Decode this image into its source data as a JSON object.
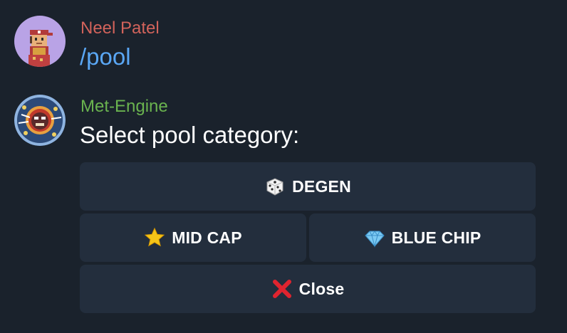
{
  "messages": [
    {
      "sender": "Neel Patel",
      "sender_color": "#d2635b",
      "text": "/pool",
      "text_color": "#5aa7f5",
      "avatar_icon": "pixel-character-avatar"
    },
    {
      "sender": "Met-Engine",
      "sender_color": "#6ab34f",
      "text": "Select pool category:",
      "text_color": "#ffffff",
      "avatar_icon": "meteor-avatar"
    }
  ],
  "keyboard": {
    "degen": {
      "icon": "dice-icon",
      "label": "DEGEN"
    },
    "mid_cap": {
      "icon": "star-icon",
      "label": "MID CAP"
    },
    "blue_chip": {
      "icon": "gem-icon",
      "label": "BLUE CHIP"
    },
    "close": {
      "icon": "cross-mark-icon",
      "label": "Close"
    }
  },
  "colors": {
    "background": "#1a222c",
    "button_bg": "#232e3d",
    "button_text": "#ffffff"
  }
}
